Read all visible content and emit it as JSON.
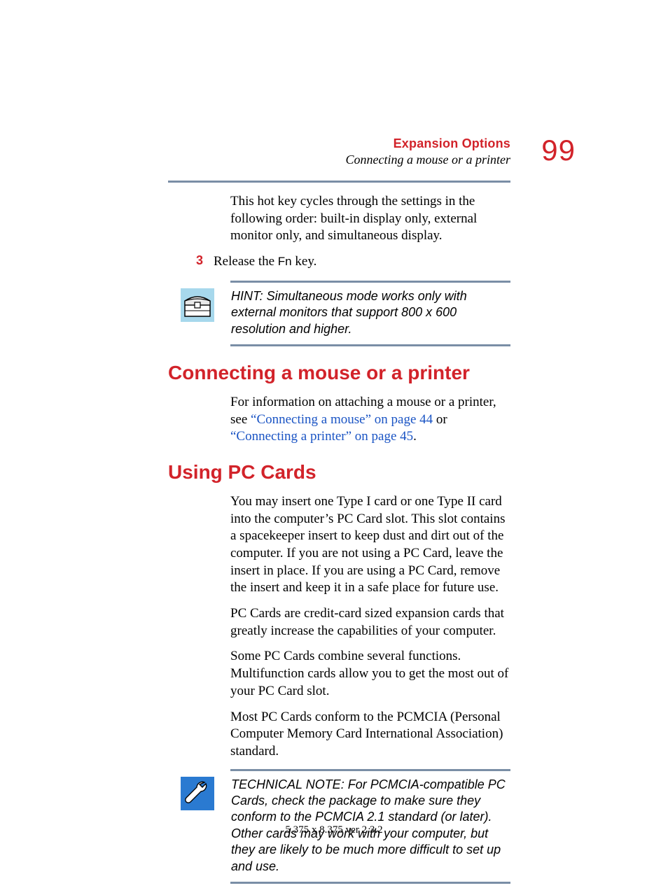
{
  "header": {
    "chapter": "Expansion Options",
    "section": "Connecting a mouse or a printer",
    "page_number": "99"
  },
  "body": {
    "intro_para": "This hot key cycles through the settings in the following order: built-in display only, external monitor only, and simultaneous display.",
    "step": {
      "num": "3",
      "pre": "Release the ",
      "key": "Fn",
      "post": " key."
    }
  },
  "hint": {
    "text": "HINT: Simultaneous mode works only with external monitors that support 800 x 600 resolution and higher."
  },
  "sections": {
    "s1": {
      "title": "Connecting a mouse or a printer",
      "p1_pre": "For information on attaching a mouse or a printer, see ",
      "link1": "“Connecting a mouse” on page 44",
      "mid": " or ",
      "link2": "“Connecting a printer” on page 45",
      "p1_post": "."
    },
    "s2": {
      "title": "Using PC Cards",
      "p1": "You may insert one Type I card or one Type II card into the computer’s PC Card slot. This slot contains a spacekeeper insert to keep dust and dirt out of the computer. If you are not using a PC Card, leave the insert in place. If you are using a PC Card, remove the insert and keep it in a safe place for future use.",
      "p2": "PC Cards are credit-card sized expansion cards that greatly increase the capabilities of your computer.",
      "p3": "Some PC Cards combine several functions. Multifunction cards allow you to get the most out of your PC Card slot.",
      "p4": "Most PC Cards conform to the PCMCIA (Personal Computer Memory Card International Association) standard."
    }
  },
  "technote": {
    "text": "TECHNICAL NOTE: For PCMCIA-compatible PC Cards, check the package to make sure they conform to the PCMCIA 2.1 standard (or later). Other cards may work with your computer, but they are likely to be much more difficult to set up and use."
  },
  "footer": "5.375 x 8.375 ver 2.3.2"
}
